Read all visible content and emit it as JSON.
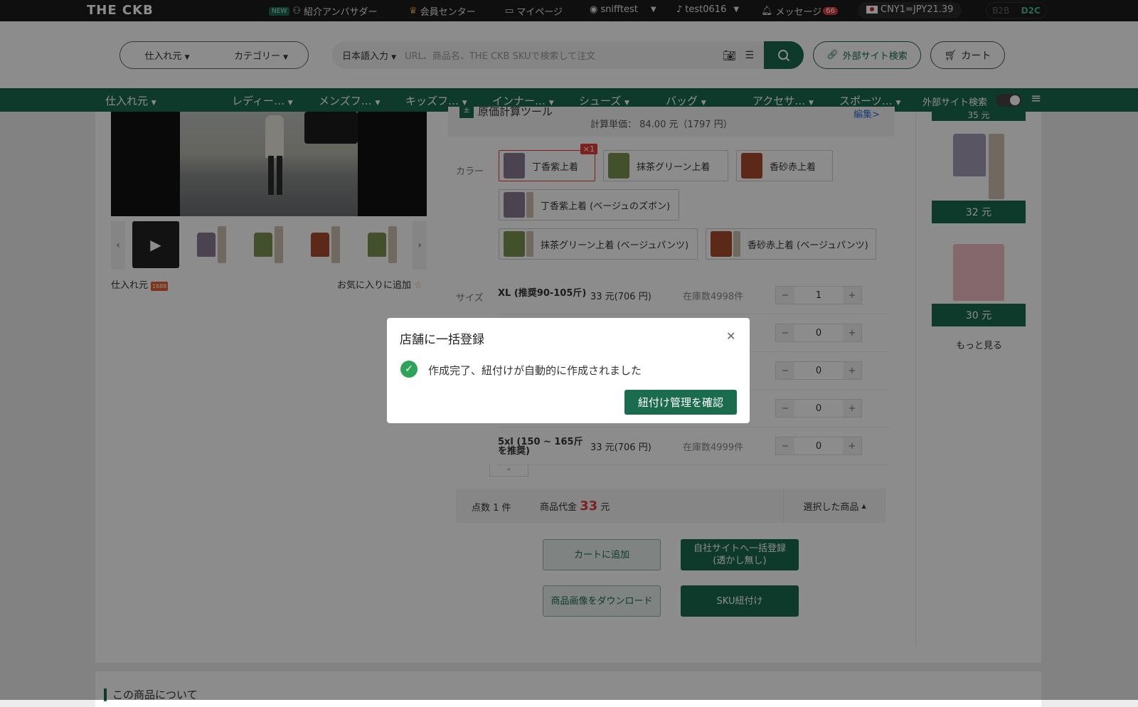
{
  "topbar": {
    "logo": "THE CKB",
    "new_badge": "NEW",
    "ambassador": "紹介アンバサダー",
    "member_center": "会員センター",
    "mypage": "マイページ",
    "store_account": "snifftest",
    "tiktok_account": "test0616",
    "messages": "メッセージ",
    "message_count": "66",
    "rate": "CNY1=JPY21.39",
    "b2b": "B2B",
    "d2c": "D2C"
  },
  "header": {
    "source_select": "仕入れ元",
    "category_select": "カテゴリー",
    "lang_select": "日本語入力",
    "search_placeholder": "URL、商品名、THE CKB SKUで検索して注文",
    "external_search": "外部サイト検索",
    "cart": "カート"
  },
  "catbar": {
    "items": [
      "仕入れ元",
      "レディー…",
      "メンズフ…",
      "キッズフ…",
      "インナー…",
      "シューズ",
      "バッグ",
      "アクセサ…",
      "スポーツ…"
    ],
    "external_toggle_label": "外部サイト検索"
  },
  "left": {
    "source_label": "仕入れ元",
    "source_badge": "1688",
    "favorite": "お気に入りに追加"
  },
  "tool": {
    "title": "原価計算ツール",
    "unit_price": "計算単価： 84.00 元（1797 円）",
    "edit": "編集>"
  },
  "colors": {
    "label": "カラー",
    "items": [
      {
        "name": "丁香紫上着",
        "swatch": "#8a7a92",
        "badge": "×1"
      },
      {
        "name": "抹茶グリーン上着",
        "swatch": "#7a9250"
      },
      {
        "name": "香砂赤上着",
        "swatch": "#a8492c"
      },
      {
        "name": "丁香紫上着 (ベージュのズボン)",
        "swatch": "#8a7a92"
      },
      {
        "name": "抹茶グリーン上着 (ベージュパンツ)",
        "swatch": "#7a9250"
      },
      {
        "name": "香砂赤上着 (ベージュパンツ)",
        "swatch": "#a8492c"
      }
    ]
  },
  "sizes": {
    "label": "サイズ",
    "rows": [
      {
        "name": "XL (推奨90-105斤)",
        "price": "33 元(706 円)",
        "stock": "在庫数4998件",
        "qty": "1"
      },
      {
        "name": "",
        "price": "",
        "stock": "",
        "qty": "0"
      },
      {
        "name": "",
        "price": "",
        "stock": "",
        "qty": "0"
      },
      {
        "name": "",
        "price": "",
        "stock": "",
        "qty": "0"
      },
      {
        "name": "5xl (150 ~ 165斤を推奨)",
        "price": "33 元(706 円)",
        "stock": "在庫数4999件",
        "qty": "0"
      }
    ]
  },
  "summary": {
    "count": "点数 1 件",
    "price_label": "商品代金",
    "price_value": "33",
    "price_unit": "元",
    "selected": "選択した商品"
  },
  "actions": {
    "add_cart": "カートに追加",
    "bulk_register": "自社サイトへ一括登録\n(透かし無し)",
    "download": "商品画像をダウンロード",
    "sku_link": "SKU紐付け"
  },
  "recommend": {
    "top_price": "35 元",
    "items": [
      {
        "price": "32 元",
        "shirt": "#a59bb4"
      },
      {
        "price": "30 元",
        "shirt": "#eebfc3"
      }
    ],
    "more": "もっと見る"
  },
  "bottom": {
    "section_title": "この商品について"
  },
  "modal": {
    "title": "店舗に一括登録",
    "message": "作成完了、紐付けが自動的に作成されました",
    "confirm": "紐付け管理を確認"
  }
}
